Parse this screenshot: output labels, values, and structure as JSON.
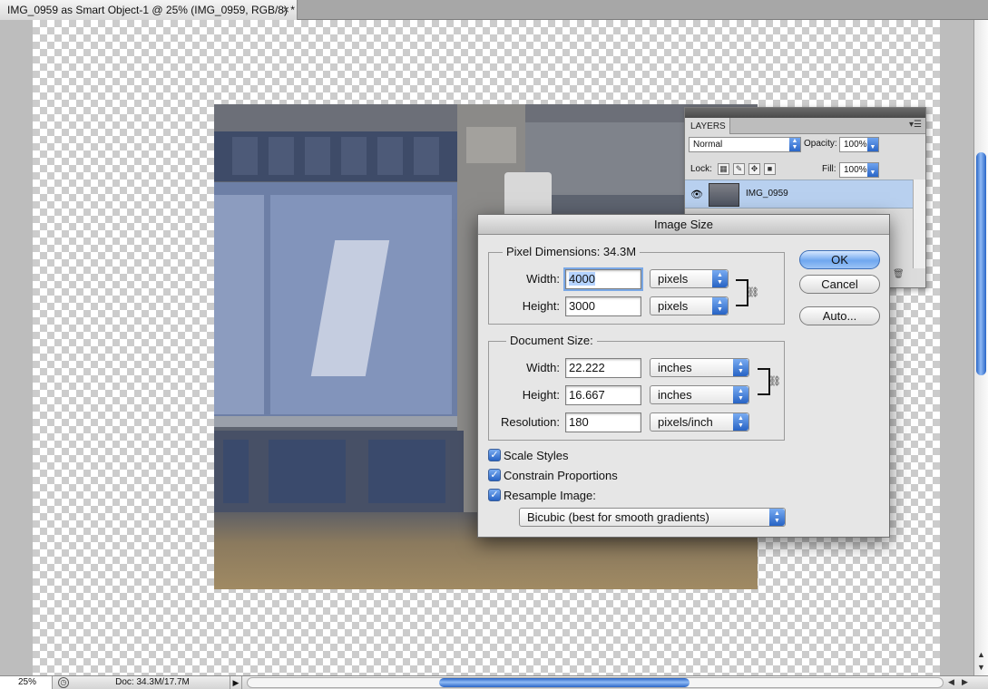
{
  "document_tab": {
    "title": "IMG_0959 as Smart Object-1 @ 25% (IMG_0959, RGB/8) *",
    "close_glyph": "×"
  },
  "status_bar": {
    "zoom": "25%",
    "doc_info": "Doc: 34.3M/17.7M",
    "arrow_glyph": "▶",
    "h_scroll_position": 0.43
  },
  "canvas": {
    "v_scroll_position": 0.35
  },
  "layers_panel": {
    "tab_label": "LAYERS",
    "blend_mode": "Normal",
    "opacity_label": "Opacity:",
    "opacity_value": "100%",
    "lock_label": "Lock:",
    "fill_label": "Fill:",
    "fill_value": "100%",
    "layer_name": "IMG_0959",
    "icons": [
      "eye-icon",
      "smart-object-thumbnail",
      "trash-icon",
      "panel-menu-icon"
    ]
  },
  "dialog": {
    "title": "Image Size",
    "pixel_dimensions": {
      "legend": "Pixel Dimensions:  34.3M",
      "width_label": "Width:",
      "width_value": "4000",
      "width_unit": "pixels",
      "height_label": "Height:",
      "height_value": "3000",
      "height_unit": "pixels"
    },
    "document_size": {
      "legend": "Document Size:",
      "width_label": "Width:",
      "width_value": "22.222",
      "width_unit": "inches",
      "height_label": "Height:",
      "height_value": "16.667",
      "height_unit": "inches",
      "resolution_label": "Resolution:",
      "resolution_value": "180",
      "resolution_unit": "pixels/inch"
    },
    "buttons": {
      "ok": "OK",
      "cancel": "Cancel",
      "auto": "Auto..."
    },
    "checkboxes": {
      "scale_styles": "Scale Styles",
      "constrain_proportions": "Constrain Proportions",
      "resample_image": "Resample Image:"
    },
    "resample_method": "Bicubic (best for smooth gradients)"
  }
}
